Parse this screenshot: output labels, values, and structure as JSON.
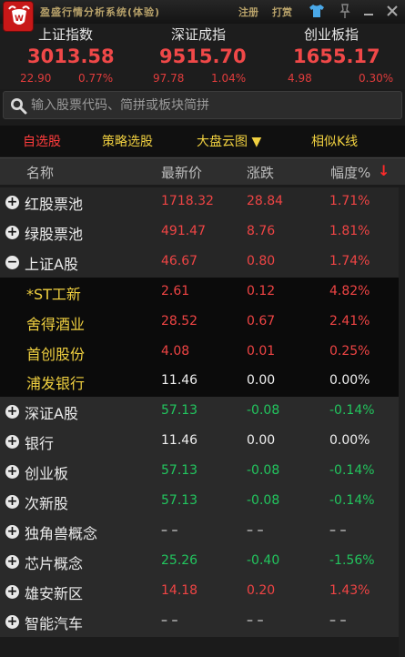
{
  "titlebar": {
    "title": "盈盛行情分析系统(体验)",
    "login_label": "注册",
    "tip_label": "打赏",
    "icons": [
      "shirt-icon",
      "pin-icon",
      "minimize-icon",
      "close-icon"
    ],
    "minimize": "—",
    "close": "×"
  },
  "indices": [
    {
      "name": "上证指数",
      "value": "3013.58",
      "change": "22.90",
      "pct": "0.77%"
    },
    {
      "name": "深证成指",
      "value": "9515.70",
      "change": "97.78",
      "pct": "1.04%"
    },
    {
      "name": "创业板指",
      "value": "1655.17",
      "change": "4.98",
      "pct": "0.30%"
    }
  ],
  "search": {
    "placeholder": "输入股票代码、简拼或板块简拼"
  },
  "tabs": [
    {
      "label": "自选股",
      "active": true
    },
    {
      "label": "策略选股",
      "active": false
    },
    {
      "label": "大盘云图 ▼",
      "active": false
    },
    {
      "label": "相似K线",
      "active": false
    }
  ],
  "table": {
    "headers": {
      "name": "名称",
      "price": "最新价",
      "change": "涨跌",
      "pct": "幅度%",
      "sort": "↓"
    },
    "rows": [
      {
        "name": "红股票池",
        "price": "1718.32",
        "change": "28.84",
        "pct": "1.71%",
        "color": "red",
        "type": "top",
        "toggle": "+"
      },
      {
        "name": "绿股票池",
        "price": "491.47",
        "change": "8.76",
        "pct": "1.81%",
        "color": "red",
        "type": "top",
        "toggle": "+"
      },
      {
        "name": "上证A股",
        "price": "46.67",
        "change": "0.80",
        "pct": "1.74%",
        "color": "red",
        "type": "top",
        "toggle": "−"
      },
      {
        "name": "*ST工新",
        "price": "2.61",
        "change": "0.12",
        "pct": "4.82%",
        "color": "red",
        "type": "sub",
        "toggle": ""
      },
      {
        "name": "舍得酒业",
        "price": "28.52",
        "change": "0.67",
        "pct": "2.41%",
        "color": "red",
        "type": "sub",
        "toggle": ""
      },
      {
        "name": "首创股份",
        "price": "4.08",
        "change": "0.01",
        "pct": "0.25%",
        "color": "red",
        "type": "sub",
        "toggle": ""
      },
      {
        "name": "浦发银行",
        "price": "11.46",
        "change": "0.00",
        "pct": "0.00%",
        "color": "white",
        "type": "sub",
        "toggle": ""
      },
      {
        "name": "深证A股",
        "price": "57.13",
        "change": "-0.08",
        "pct": "-0.14%",
        "color": "green",
        "type": "level",
        "toggle": "+"
      },
      {
        "name": "银行",
        "price": "11.46",
        "change": "0.00",
        "pct": "0.00%",
        "color": "white",
        "type": "level",
        "toggle": "+"
      },
      {
        "name": "创业板",
        "price": "57.13",
        "change": "-0.08",
        "pct": "-0.14%",
        "color": "green",
        "type": "level",
        "toggle": "+"
      },
      {
        "name": "次新股",
        "price": "57.13",
        "change": "-0.08",
        "pct": "-0.14%",
        "color": "green",
        "type": "level",
        "toggle": "+"
      },
      {
        "name": "独角兽概念",
        "price": "– –",
        "change": "– –",
        "pct": "– –",
        "color": "white",
        "type": "level",
        "toggle": "+"
      },
      {
        "name": "芯片概念",
        "price": "25.26",
        "change": "-0.40",
        "pct": "-1.56%",
        "color": "green",
        "type": "level",
        "toggle": "+"
      },
      {
        "name": "雄安新区",
        "price": "14.18",
        "change": "0.20",
        "pct": "1.43%",
        "color": "red",
        "type": "level",
        "toggle": "+"
      },
      {
        "name": "智能汽车",
        "price": "– –",
        "change": "– –",
        "pct": "– –",
        "color": "white",
        "type": "level",
        "toggle": "+"
      }
    ]
  },
  "colors": {
    "up": "#ef4444",
    "down": "#22c55e",
    "flat": "#f0f0f0",
    "accent": "#f0d040",
    "active_tab": "#ff3c3c"
  }
}
